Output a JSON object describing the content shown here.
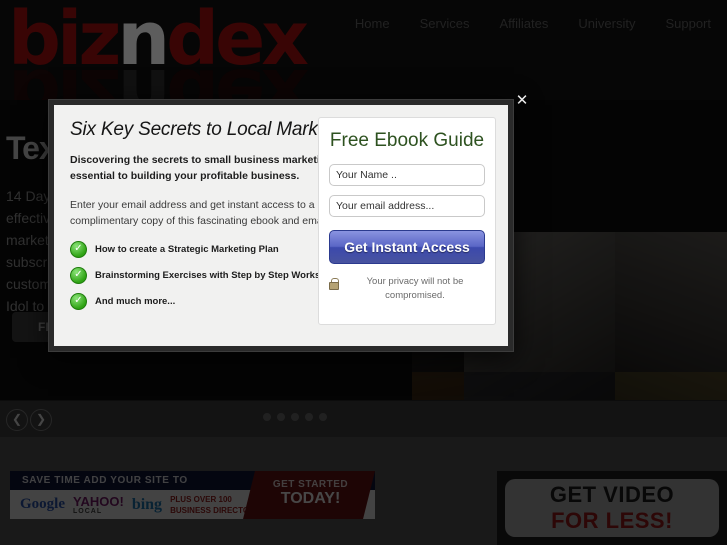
{
  "site": {
    "logo": {
      "prefix": "biz",
      "highlight": "n",
      "suffix": "dex"
    },
    "nav": [
      {
        "label": "Home"
      },
      {
        "label": "Services"
      },
      {
        "label": "Affiliates"
      },
      {
        "label": "University"
      },
      {
        "label": "Support"
      }
    ],
    "hero": {
      "heading": "Tex",
      "lines": [
        "14 Day",
        "effectiv",
        "market",
        "subscri",
        "custom",
        "Idol to"
      ],
      "button_label": "FIND"
    },
    "carousel": {
      "prev_icon": "arrow-left-icon",
      "next_icon": "arrow-right-icon",
      "dot_count": 5,
      "active_index": 0
    },
    "banner_directories": {
      "top_line": "SAVE TIME ADD YOUR SITE TO",
      "logos": [
        "Google",
        "YAHOO!",
        "LOCAL",
        "bing"
      ],
      "plus_line_1": "PLUS OVER 100",
      "plus_line_2": "BUSINESS DIRECTORIES",
      "cta_line_1": "GET STARTED",
      "cta_line_2": "TODAY!"
    },
    "banner_video": {
      "line_1": "GET VIDEO",
      "line_2": "FOR LESS!"
    }
  },
  "modal": {
    "close_label": "✕",
    "title": "Six Key Secrets to Local Marketing",
    "lead": "Discovering the secrets to small business marketing are essential to building your profitable business.",
    "body": "Enter your email address and get instant access to a complimentary copy of this fascinating ebook and email course.",
    "bullets": [
      {
        "check": "✓",
        "text": "How to create a Strategic Marketing Plan"
      },
      {
        "check": "✓",
        "text": "Brainstorming Exercises with Step by Step Worksheets"
      },
      {
        "check": "✓",
        "text": "And much more..."
      }
    ],
    "form": {
      "heading": "Free Ebook Guide",
      "name_placeholder": "Your Name ..",
      "name_value": "",
      "email_placeholder": "Your email address...",
      "email_value": "",
      "submit_label": "Get Instant Access",
      "privacy": "Your privacy will not be compromised."
    }
  },
  "colors": {
    "logo_red": "#7e0c0c",
    "heading_green": "#2e5220",
    "cta_blue": "#4a56b8",
    "check_green": "#2fa314",
    "page_dark": "#0d0d0d"
  }
}
